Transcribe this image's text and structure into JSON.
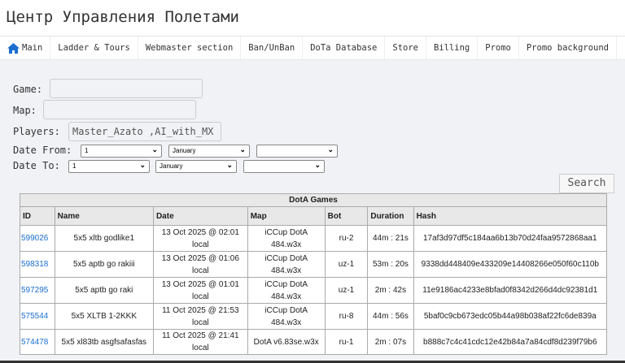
{
  "header": {
    "title": "Центр Управления Полетами"
  },
  "nav": [
    {
      "label": "Main",
      "icon": "home-icon"
    },
    {
      "label": "Ladder & Tours"
    },
    {
      "label": "Webmaster section"
    },
    {
      "label": "Ban/UnBan"
    },
    {
      "label": "DoTa Database"
    },
    {
      "label": "Store"
    },
    {
      "label": "Billing"
    },
    {
      "label": "Promo"
    },
    {
      "label": "Promo background"
    }
  ],
  "form": {
    "game_label": "Game:",
    "game_value": "",
    "map_label": "Map:",
    "map_value": "",
    "players_label": "Players:",
    "players_value": "Master_Azato ,AI_with_MX",
    "date_from_label": "Date From:",
    "date_from": {
      "day": "1",
      "month": "January",
      "year": ""
    },
    "date_to_label": "Date To:",
    "date_to": {
      "day": "1",
      "month": "January",
      "year": ""
    },
    "search_label": "Search"
  },
  "table": {
    "caption": "DotA Games",
    "columns": [
      "ID",
      "Name",
      "Date",
      "Map",
      "Bot",
      "Duration",
      "Hash"
    ],
    "rows": [
      [
        "599026",
        "5x5 xltb godlike1",
        "13 Oct 2025 @ 02:01 local",
        "iCCup DotA 484.w3x",
        "ru-2",
        "44m : 21s",
        "17af3d97df5c184aa6b13b70d24faa9572868aa1"
      ],
      [
        "598318",
        "5x5 aptb go rakiii",
        "13 Oct 2025 @ 01:06 local",
        "iCCup DotA 484.w3x",
        "uz-1",
        "53m : 20s",
        "9338dd448409e433209e14408266e050f60c110b"
      ],
      [
        "597295",
        "5x5 aptb go raki",
        "13 Oct 2025 @ 01:01 local",
        "iCCup DotA 484.w3x",
        "uz-1",
        "2m : 42s",
        "11e9186ac4233e8bfad0f8342d266d4dc92381d1"
      ],
      [
        "575544",
        "5x5 XLTB 1-2KKK",
        "11 Oct 2025 @ 21:53 local",
        "iCCup DotA 484.w3x",
        "ru-8",
        "44m : 56s",
        "5baf0c9cb673edc05b44a98b038af22fc6de839a"
      ],
      [
        "574478",
        "5x5 xl83tb asgfsafasfas",
        "11 Oct 2025 @ 21:41 local",
        "DotA v6.83se.w3x",
        "ru-1",
        "2m : 07s",
        "b888c7c4c41cdc12e42b84a7a84cdf8d239f79b6"
      ]
    ]
  },
  "colors": {
    "link": "#1a6fd1",
    "home_icon": "#1a6fd1",
    "background": "#f1f2f6"
  }
}
